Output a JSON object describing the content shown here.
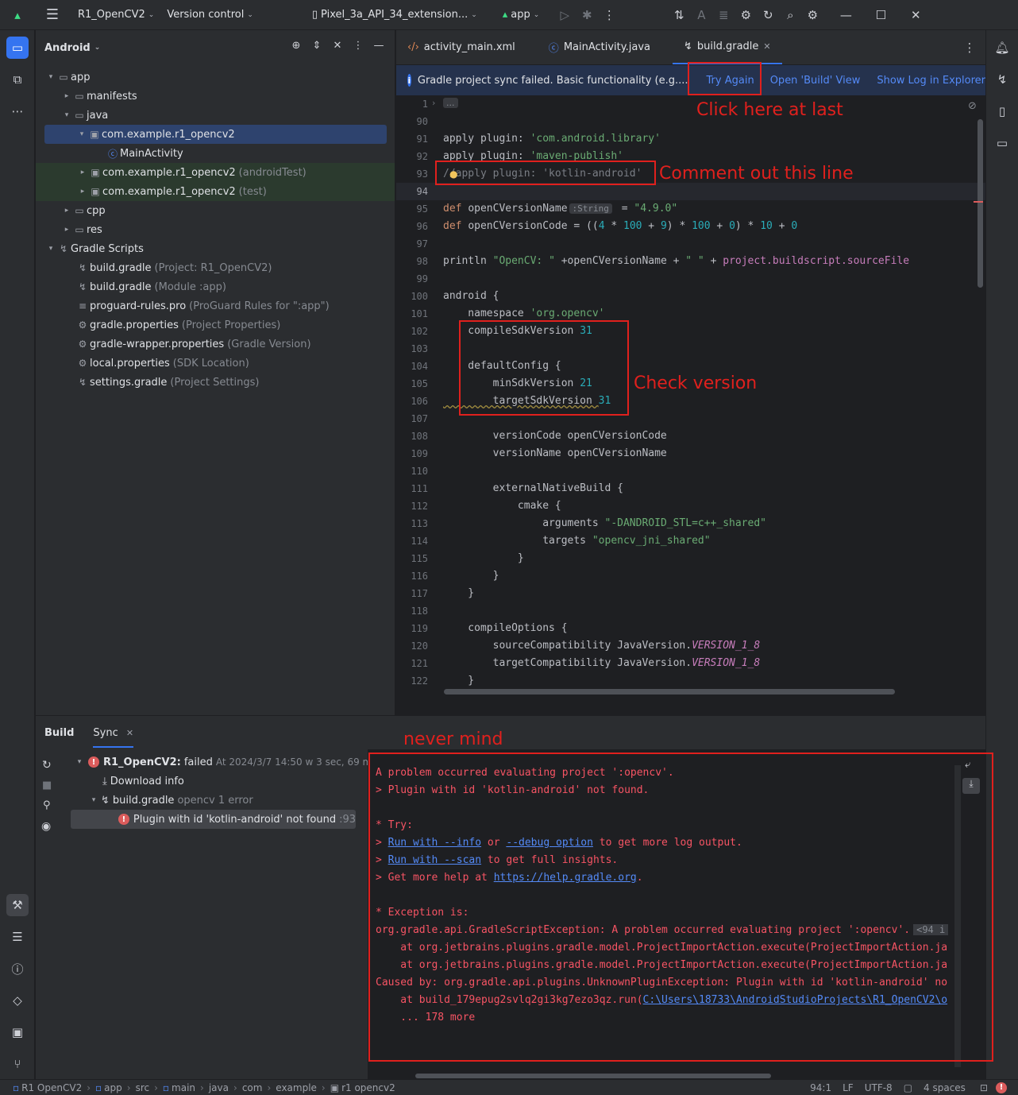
{
  "titlebar": {
    "project": "R1_OpenCV2",
    "vcs": "Version control",
    "device": "Pixel_3a_API_34_extension...",
    "run_config": "app"
  },
  "project_panel": {
    "title": "Android",
    "tree": [
      {
        "label": "app",
        "muted": ""
      },
      {
        "label": "manifests",
        "muted": ""
      },
      {
        "label": "java",
        "muted": ""
      },
      {
        "label": "com.example.r1_opencv2",
        "muted": ""
      },
      {
        "label": "MainActivity",
        "muted": ""
      },
      {
        "label": "com.example.r1_opencv2",
        "muted": "(androidTest)"
      },
      {
        "label": "com.example.r1_opencv2",
        "muted": "(test)"
      },
      {
        "label": "cpp",
        "muted": ""
      },
      {
        "label": "res",
        "muted": ""
      },
      {
        "label": "Gradle Scripts",
        "muted": ""
      },
      {
        "label": "build.gradle",
        "muted": "(Project: R1_OpenCV2)"
      },
      {
        "label": "build.gradle",
        "muted": "(Module :app)"
      },
      {
        "label": "proguard-rules.pro",
        "muted": "(ProGuard Rules for \":app\")"
      },
      {
        "label": "gradle.properties",
        "muted": "(Project Properties)"
      },
      {
        "label": "gradle-wrapper.properties",
        "muted": "(Gradle Version)"
      },
      {
        "label": "local.properties",
        "muted": "(SDK Location)"
      },
      {
        "label": "settings.gradle",
        "muted": "(Project Settings)"
      }
    ]
  },
  "editor": {
    "tabs": [
      "activity_main.xml",
      "MainActivity.java",
      "build.gradle"
    ],
    "banner": {
      "message": "Gradle project sync failed. Basic functionality (e.g....",
      "try_again": "Try Again",
      "open_build": "Open 'Build' View",
      "show_log": "Show Log in Explorer"
    },
    "line_numbers": [
      "1",
      "90",
      "91",
      "92",
      "93",
      "94",
      "95",
      "96",
      "97",
      "98",
      "99",
      "100",
      "101",
      "102",
      "103",
      "104",
      "105",
      "106",
      "107",
      "108",
      "109",
      "110",
      "111",
      "112",
      "113",
      "114",
      "115",
      "116",
      "117",
      "118",
      "119",
      "120",
      "121",
      "122"
    ],
    "code": {
      "l91a": "apply plugin: ",
      "l91b": "'com.android.library'",
      "l92a": "apply plugin: ",
      "l92b": "'maven-publish'",
      "l93": "//apply plugin: 'kotlin-android'",
      "l95a": "def ",
      "l95b": "openCVersionName",
      "l95hint": ":String",
      "l95c": " = ",
      "l95d": "\"4.9.0\"",
      "l96a": "def ",
      "l96b": "openCVersionCode = ((",
      "l96n1": "4",
      "l96c": " * ",
      "l96n2": "100",
      "l96d": " + ",
      "l96n3": "9",
      "l96e": ") * ",
      "l96n4": "100",
      "l96f": " + ",
      "l96n5": "0",
      "l96g": ") * ",
      "l96n6": "10",
      "l96h": " + ",
      "l96n7": "0",
      "l98a": "println ",
      "l98b": "\"OpenCV: \"",
      "l98c": " +openCVersionName + ",
      "l98d": "\" \"",
      "l98e": " + ",
      "l98f": "project.buildscript.sourceFile",
      "l100": "android {",
      "l101a": "    namespace ",
      "l101b": "'org.opencv'",
      "l102a": "    compileSdkVersion ",
      "l102b": "31",
      "l104": "    defaultConfig {",
      "l105a": "        minSdkVersion ",
      "l105b": "21",
      "l106a": "        targetSdkVersion ",
      "l106b": "31",
      "l108": "        versionCode openCVersionCode",
      "l109": "        versionName openCVersionName",
      "l111": "        externalNativeBuild {",
      "l112": "            cmake {",
      "l113a": "                arguments ",
      "l113b": "\"-DANDROID_STL=c++_shared\"",
      "l114a": "                targets ",
      "l114b": "\"opencv_jni_shared\"",
      "l115": "            }",
      "l116": "        }",
      "l117": "    }",
      "l119": "    compileOptions {",
      "l120a": "        sourceCompatibility JavaVersion.",
      "l120b": "VERSION_1_8",
      "l121a": "        targetCompatibility JavaVersion.",
      "l121b": "VERSION_1_8",
      "l122": "    }"
    }
  },
  "annotations": {
    "click_last": "Click here at last",
    "comment_out": "Comment out this line",
    "check_version": "Check version",
    "never_mind": "never mind"
  },
  "build_panel": {
    "tab_build": "Build",
    "tab_sync": "Sync",
    "tree": {
      "root_name": "R1_OpenCV2:",
      "root_status": "failed",
      "root_time": "At 2024/3/7 14:50 w 3 sec, 69 ms",
      "download": "Download info",
      "file": "build.gradle",
      "file_meta": "opencv 1 error",
      "error": "Plugin with id 'kotlin-android' not found",
      "error_line": ":93"
    },
    "console": {
      "l1": "A problem occurred evaluating project ':opencv'.",
      "l2": "> Plugin with id 'kotlin-android' not found.",
      "l3": "* Try:",
      "l4a": "> ",
      "l4b": "Run with --info",
      "l4c": " or ",
      "l4d": "--debug option",
      "l4e": " to get more log output.",
      "l5a": "> ",
      "l5b": "Run with --scan",
      "l5c": " to get full insights.",
      "l6a": "> Get more help at ",
      "l6b": "https://help.gradle.org",
      "l6c": ".",
      "l7": "* Exception is:",
      "l8": "org.gradle.api.GradleScriptException: A problem occurred evaluating project ':opencv'.",
      "l8badge": "<94 i",
      "l9": "    at org.jetbrains.plugins.gradle.model.ProjectImportAction.execute(ProjectImportAction.ja",
      "l10": "    at org.jetbrains.plugins.gradle.model.ProjectImportAction.execute(ProjectImportAction.ja",
      "l11": "Caused by: org.gradle.api.plugins.UnknownPluginException: Plugin with id 'kotlin-android' no",
      "l12a": "    at build_179epug2svlq2gi3kg7ezo3qz.run(",
      "l12b": "C:\\Users\\18733\\AndroidStudioProjects\\R1_OpenCV2\\o",
      "l13": "    ... 178 more"
    }
  },
  "statusbar": {
    "crumbs": [
      "R1 OpenCV2",
      "app",
      "src",
      "main",
      "java",
      "com",
      "example",
      "r1 opencv2"
    ],
    "position": "94:1",
    "line_sep": "LF",
    "encoding": "UTF-8",
    "indent": "4 spaces"
  }
}
